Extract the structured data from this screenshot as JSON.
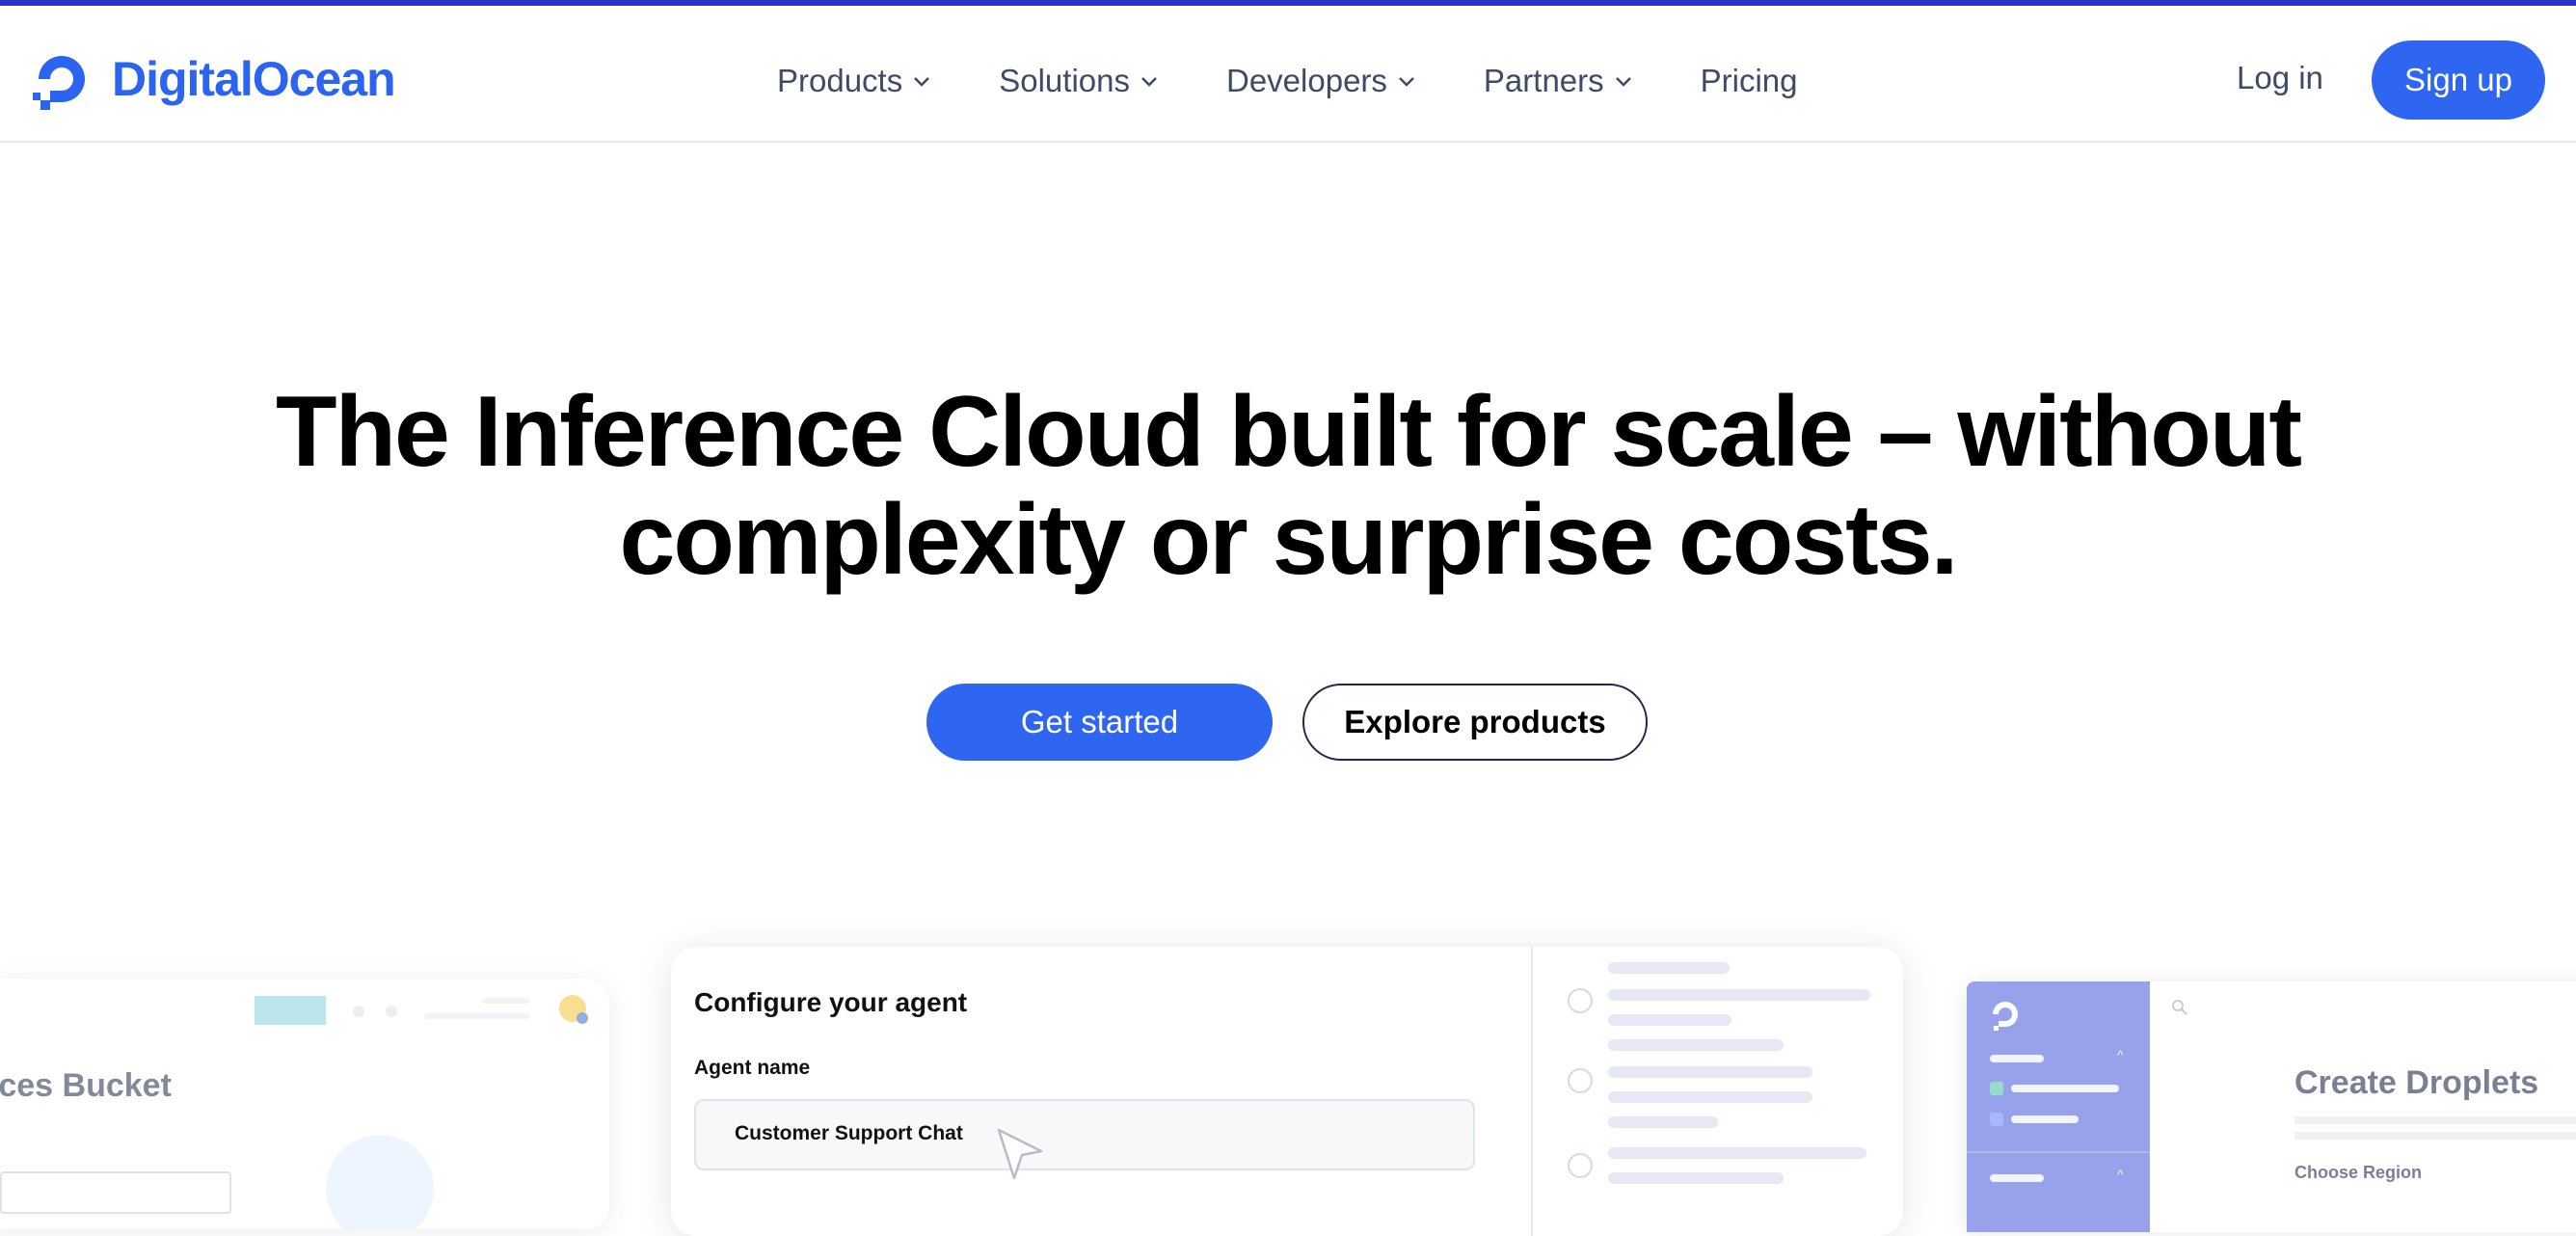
{
  "colors": {
    "brand": "#2b64f0",
    "top_strip": "#2b32c9",
    "primary_button": "#2e66f2",
    "nav_text": "#3e4a66",
    "heading_text": "#000000"
  },
  "header": {
    "brand_name": "DigitalOcean",
    "nav": [
      {
        "label": "Products",
        "has_menu": true
      },
      {
        "label": "Solutions",
        "has_menu": true
      },
      {
        "label": "Developers",
        "has_menu": true
      },
      {
        "label": "Partners",
        "has_menu": true
      },
      {
        "label": "Pricing",
        "has_menu": false
      }
    ],
    "login_label": "Log in",
    "signup_label": "Sign up"
  },
  "hero": {
    "title_line1": "The Inference Cloud built for scale – without",
    "title_line2": "complexity or surprise costs.",
    "primary_cta": "Get started",
    "secondary_cta": "Explore products"
  },
  "previews": {
    "left": {
      "title": "Spaces Bucket"
    },
    "center": {
      "heading": "Configure your agent",
      "field_label": "Agent name",
      "field_value": "Customer Support Chat"
    },
    "right": {
      "title": "Create Droplets",
      "subtitle": "Choose Region"
    }
  }
}
